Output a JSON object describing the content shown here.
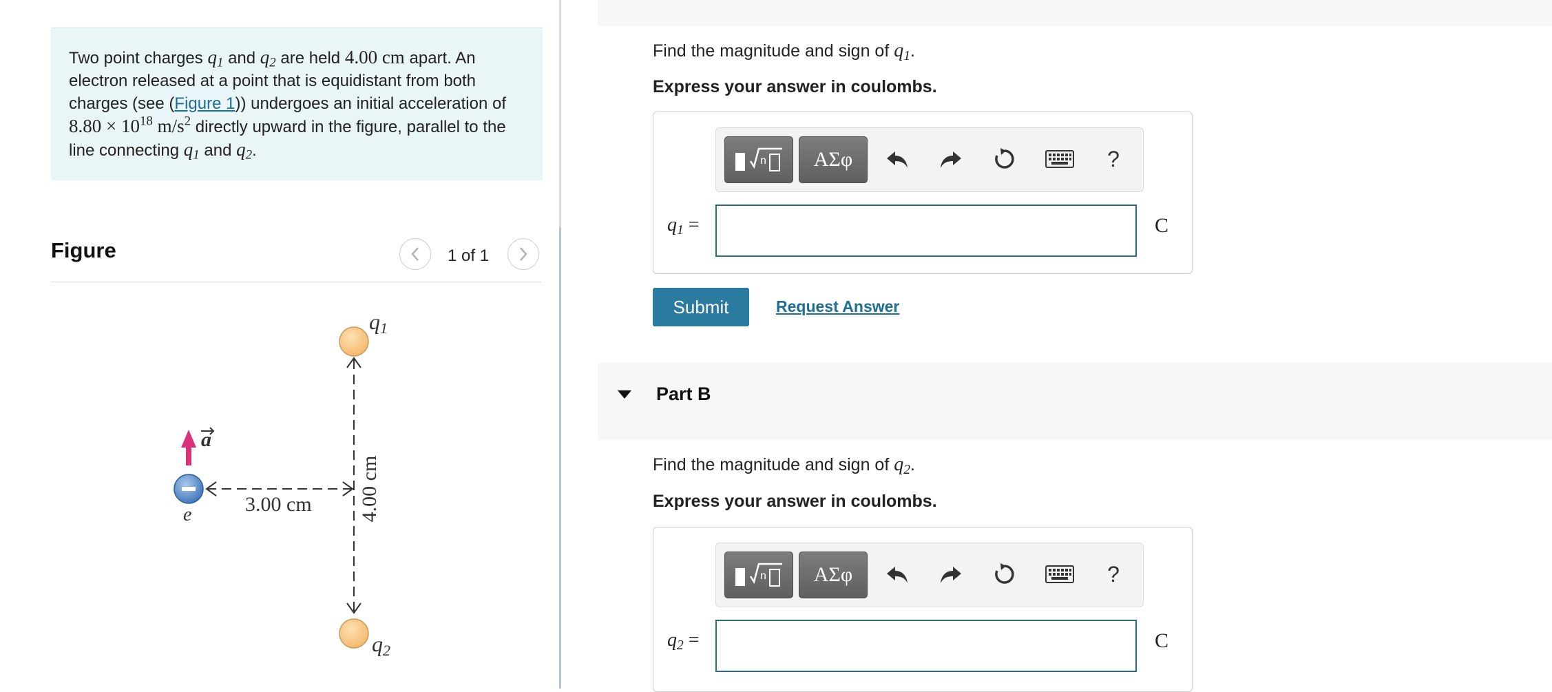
{
  "problem": {
    "text_1": "Two point charges ",
    "q1_symbol": "q",
    "q1_sub": "1",
    "text_2": " and ",
    "q2_symbol": "q",
    "q2_sub": "2",
    "text_3": " are held ",
    "distance_value": "4.00",
    "distance_unit": "cm",
    "text_4": " apart. An electron released at a point that is equidistant from both charges (see (",
    "figure_link": "Figure 1",
    "text_5": ")) undergoes an initial acceleration of ",
    "accel_mantissa": "8.80 × 10",
    "accel_exp": "18",
    "accel_unit_a": "m/s",
    "accel_unit_exp": "2",
    "text_6": " directly upward in the figure, parallel to the line connecting ",
    "text_7": " and ",
    "text_8": "."
  },
  "figure": {
    "title": "Figure",
    "pager_text": "1 of 1",
    "prev_icon": "chevron-left-icon",
    "next_icon": "chevron-right-icon",
    "label_q1": "q",
    "label_q1_sub": "1",
    "label_q2": "q",
    "label_q2_sub": "2",
    "label_a": "a",
    "label_e": "e",
    "label_horizontal": "3.00 cm",
    "label_vertical": "4.00 cm",
    "colors": {
      "charge_fill": "#f9c98a",
      "electron_fill": "#4f86c6",
      "arrow": "#d8327a"
    }
  },
  "partA": {
    "prompt": "Find the magnitude and sign of ",
    "var": "q",
    "var_sub": "1",
    "prompt_end": ".",
    "instruction": "Express your answer in coulombs.",
    "answer_label": "q",
    "answer_label_sub": "1",
    "answer_eq": " =",
    "unit": "C",
    "input_value": "",
    "toolbar": {
      "templates_icon": "templates-icon",
      "greek_label": "ΑΣφ",
      "undo_icon": "undo-icon",
      "redo_icon": "redo-icon",
      "reset_icon": "reset-icon",
      "keyboard_icon": "keyboard-icon",
      "help_label": "?"
    },
    "submit_label": "Submit",
    "request_label": "Request Answer"
  },
  "partB": {
    "title": "Part B",
    "prompt": "Find the magnitude and sign of ",
    "var": "q",
    "var_sub": "2",
    "prompt_end": ".",
    "instruction": "Express your answer in coulombs.",
    "answer_label": "q",
    "answer_label_sub": "2",
    "answer_eq": " =",
    "unit": "C",
    "input_value": "",
    "toolbar": {
      "greek_label": "ΑΣφ",
      "help_label": "?"
    }
  }
}
